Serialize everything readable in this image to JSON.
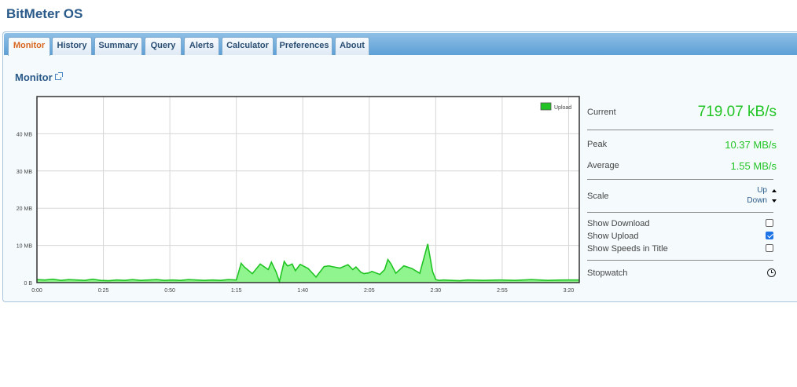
{
  "app": {
    "title": "BitMeter OS"
  },
  "tabs": [
    {
      "label": "Monitor",
      "active": true
    },
    {
      "label": "History",
      "active": false
    },
    {
      "label": "Summary",
      "active": false
    },
    {
      "label": "Query",
      "active": false
    },
    {
      "label": "Alerts",
      "active": false
    },
    {
      "label": "Calculator",
      "active": false
    },
    {
      "label": "Preferences",
      "active": false
    },
    {
      "label": "About",
      "active": false
    }
  ],
  "monitor": {
    "title": "Monitor",
    "popout_icon": "external-link-icon"
  },
  "stats": {
    "current_label": "Current",
    "current_value": "719.07 kB/s",
    "peak_label": "Peak",
    "peak_value": "10.37 MB/s",
    "average_label": "Average",
    "average_value": "1.55 MB/s",
    "scale_label": "Scale",
    "scale_up": "Up",
    "scale_down": "Down",
    "show_download_label": "Show Download",
    "show_download": false,
    "show_upload_label": "Show Upload",
    "show_upload": true,
    "show_speeds_label": "Show Speeds in Title",
    "show_speeds": false,
    "stopwatch_label": "Stopwatch",
    "stopwatch_icon": "clock-icon"
  },
  "colors": {
    "accent": "#2a5a8a",
    "upload": "#21c424",
    "upload_fill": "#90f58e",
    "active_tab": "#d9661f"
  },
  "chart_data": {
    "type": "area",
    "title": "",
    "xlabel": "",
    "ylabel": "",
    "legend": "top-right",
    "grid": true,
    "xlim": [
      0,
      3.4
    ],
    "ylim": [
      0,
      50
    ],
    "y_ticks": [
      0,
      10,
      20,
      30,
      40
    ],
    "y_tick_labels": [
      "0 B",
      "10 MB",
      "20 MB",
      "30 MB",
      "40 MB"
    ],
    "x_ticks": [
      0,
      0.4167,
      0.8333,
      1.25,
      1.6667,
      2.0833,
      2.5,
      2.9167,
      3.3333
    ],
    "x_tick_labels": [
      "0:00",
      "0:25",
      "0:50",
      "1:15",
      "1:40",
      "2:05",
      "2:30",
      "2:55",
      "3:20"
    ],
    "series": [
      {
        "name": "Upload",
        "color": "#21c424",
        "x": [
          0,
          0.05,
          0.1,
          0.15,
          0.2,
          0.25,
          0.3,
          0.35,
          0.4,
          0.45,
          0.5,
          0.55,
          0.6,
          0.65,
          0.7,
          0.75,
          0.8,
          0.85,
          0.9,
          0.95,
          1.0,
          1.05,
          1.1,
          1.15,
          1.2,
          1.25,
          1.28,
          1.3,
          1.35,
          1.4,
          1.45,
          1.47,
          1.5,
          1.52,
          1.55,
          1.57,
          1.58,
          1.6,
          1.62,
          1.65,
          1.7,
          1.75,
          1.8,
          1.83,
          1.85,
          1.9,
          1.95,
          1.98,
          2.0,
          2.03,
          2.05,
          2.08,
          2.1,
          2.15,
          2.18,
          2.2,
          2.22,
          2.25,
          2.3,
          2.35,
          2.4,
          2.45,
          2.48,
          2.5,
          2.52,
          2.55,
          2.6,
          2.65,
          2.7,
          2.8,
          2.9,
          3.0,
          3.1,
          3.2,
          3.3,
          3.4
        ],
        "values": [
          0.8,
          0.7,
          0.9,
          0.6,
          0.8,
          0.7,
          0.6,
          0.9,
          0.6,
          0.5,
          0.7,
          0.6,
          0.8,
          0.6,
          0.7,
          0.8,
          0.6,
          0.7,
          0.6,
          0.8,
          0.7,
          0.6,
          0.7,
          0.6,
          0.8,
          0.7,
          5.2,
          4.2,
          2.4,
          5.0,
          3.5,
          5.5,
          2.8,
          0.3,
          5.7,
          4.5,
          4.6,
          5.0,
          3.2,
          4.9,
          3.8,
          1.5,
          4.3,
          4.5,
          4.3,
          3.9,
          4.8,
          3.5,
          4.2,
          2.8,
          2.4,
          2.6,
          3.0,
          2.2,
          3.5,
          6.2,
          5.0,
          2.5,
          4.5,
          3.8,
          2.5,
          10.37,
          3.0,
          0.8,
          0.6,
          0.7,
          0.6,
          0.5,
          0.7,
          0.6,
          0.7,
          0.6,
          0.8,
          0.6,
          0.7,
          0.7
        ]
      }
    ]
  }
}
